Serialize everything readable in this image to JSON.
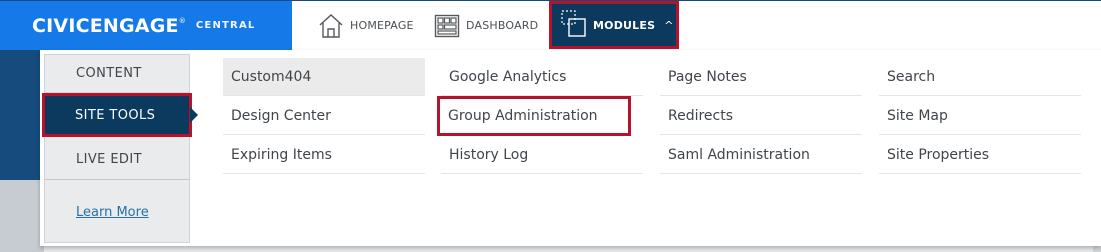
{
  "brand": {
    "name": "CIVICENGAGE",
    "trademark": "®",
    "sub": "CENTRAL",
    "color": "#1679e8"
  },
  "nav": {
    "homepage": {
      "label": "HOMEPAGE",
      "icon": "home-icon"
    },
    "dashboard": {
      "label": "DASHBOARD",
      "icon": "dashboard-icon"
    },
    "modules": {
      "label": "MODULES",
      "icon": "modules-icon",
      "chevron": "^"
    }
  },
  "sidebar": {
    "items": [
      {
        "label": "CONTENT",
        "active": false
      },
      {
        "label": "SITE TOOLS",
        "active": true
      },
      {
        "label": "LIVE EDIT",
        "active": false
      }
    ],
    "learn_more": "Learn More"
  },
  "modules_grid": {
    "columns": [
      [
        "Custom404",
        "Design Center",
        "Expiring Items"
      ],
      [
        "Google Analytics",
        "Group Administration",
        "History Log"
      ],
      [
        "Page Notes",
        "Redirects",
        "Saml Administration"
      ],
      [
        "Search",
        "Site Map",
        "Site Properties"
      ]
    ],
    "highlighted": "Custom404",
    "boxed": "Group Administration"
  },
  "colors": {
    "active_nav": "#0c3a5e",
    "highlight_border": "#b5122b",
    "link": "#2770a8"
  }
}
